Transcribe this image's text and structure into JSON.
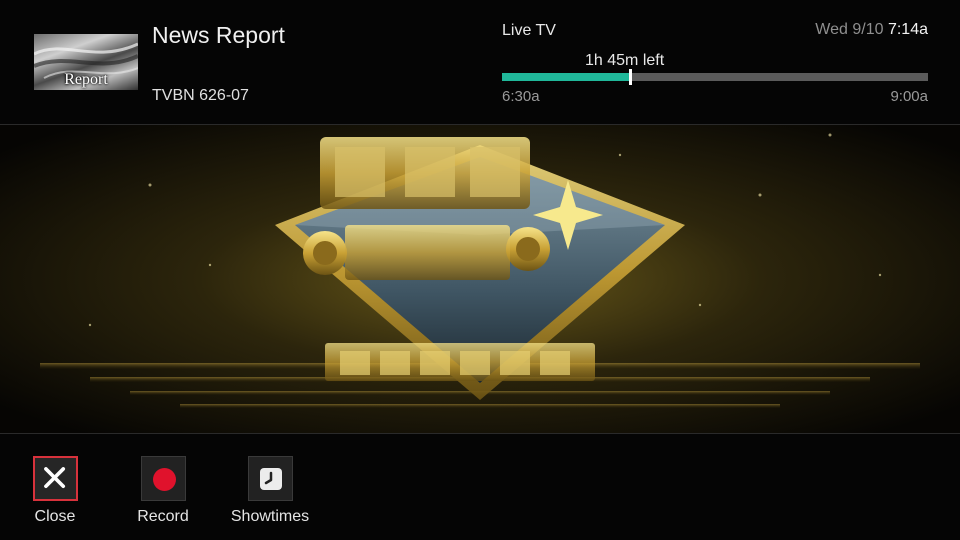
{
  "header": {
    "thumbnail_text": "Report",
    "show_title": "News Report",
    "channel": "TVBN 626-07",
    "mode_label": "Live TV",
    "time_remaining": "1h 45m left",
    "start_time": "6:30a",
    "end_time": "9:00a",
    "progress_fraction": 0.3,
    "date": "Wed 9/10",
    "current_time": "7:14a",
    "accent_color": "#20b89a"
  },
  "actions": [
    {
      "label": "Close",
      "icon": "close-icon",
      "focused": true
    },
    {
      "label": "Record",
      "icon": "record-icon",
      "focused": false
    },
    {
      "label": "Showtimes",
      "icon": "clock-icon",
      "focused": false
    }
  ],
  "colors": {
    "focus_border": "#d8323c",
    "record": "#e0122c"
  }
}
